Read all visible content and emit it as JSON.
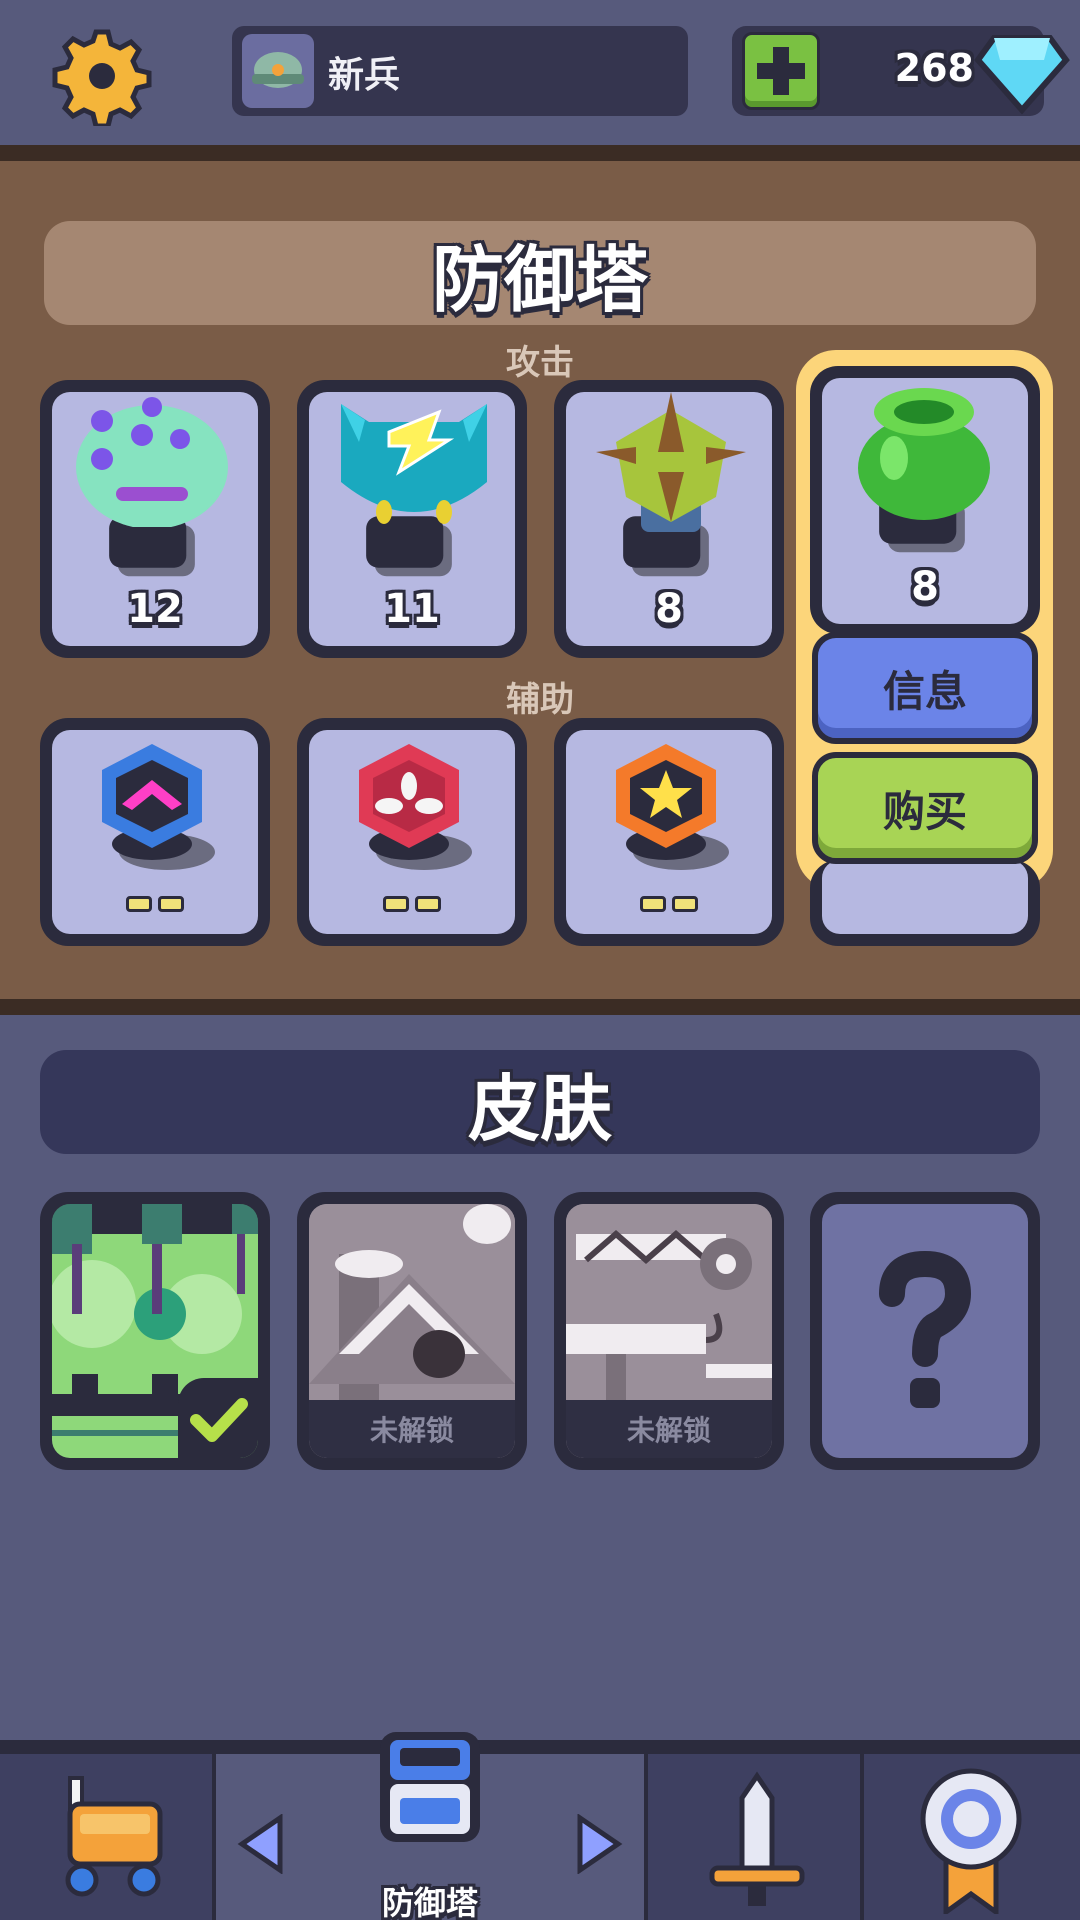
{
  "topbar": {
    "settings_icon": "gear-icon",
    "rank": {
      "label": "新兵",
      "icon": "soldier-helmet-icon"
    },
    "gems": {
      "count": "268",
      "add_icon": "plus-icon",
      "gem_icon": "diamond-icon"
    }
  },
  "towers": {
    "title": "防御塔",
    "attack_label": "攻击",
    "support_label": "辅助",
    "attack_cards": [
      {
        "name": "spore-tower",
        "level": "12"
      },
      {
        "name": "lightning-tower",
        "level": "11"
      },
      {
        "name": "spike-tower",
        "level": "8"
      },
      {
        "name": "acid-pot-tower",
        "level": "8"
      }
    ],
    "support_cards": [
      {
        "name": "boost-tower"
      },
      {
        "name": "repair-tower"
      },
      {
        "name": "star-tower"
      }
    ],
    "actions": {
      "info": "信息",
      "buy": "购买"
    }
  },
  "skins": {
    "title": "皮肤",
    "locked_label": "未解锁",
    "items": [
      {
        "name": "factory-skin",
        "status": "selected"
      },
      {
        "name": "snow-skin",
        "status": "locked"
      },
      {
        "name": "construction-skin",
        "status": "locked"
      },
      {
        "name": "mystery-skin",
        "status": "hidden"
      }
    ]
  },
  "bottom_nav": {
    "active_label": "防御塔",
    "items": [
      "shop-cart-icon",
      "tower-icon",
      "sword-icon",
      "medal-icon"
    ]
  },
  "colors": {
    "background": "#575a7c",
    "brown_panel": "#7a5c47",
    "highlight": "#fcd57a",
    "info_button": "#6b84e8",
    "buy_button": "#a8d455"
  }
}
